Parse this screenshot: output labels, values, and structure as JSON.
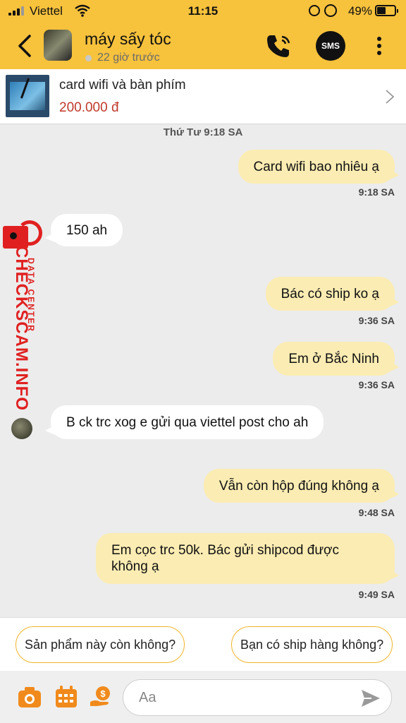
{
  "status_bar": {
    "carrier": "Viettel",
    "time": "11:15",
    "battery": "49%"
  },
  "header": {
    "title": "máy sấy tóc",
    "last_seen": "22 giờ trước",
    "sms_label": "SMS"
  },
  "product": {
    "name": "card wifi và bàn phím",
    "price": "200.000 đ"
  },
  "chat": {
    "day_label": "Thứ Tư 9:18 SA",
    "messages": [
      {
        "text": "Card wifi bao nhiêu ạ",
        "time": "9:18 SA"
      },
      {
        "text": "150 ah"
      },
      {
        "text": "Bác có ship ko ạ",
        "time": "9:36 SA"
      },
      {
        "text": "Em ở Bắc Ninh",
        "time": "9:36 SA"
      },
      {
        "text": "B ck trc xog e gửi qua viettel post cho ah"
      },
      {
        "text": "Vẫn còn hộp đúng không ạ",
        "time": "9:48 SA"
      },
      {
        "text": "Em cọc trc 50k. Bác gửi shipcod được không ạ",
        "time": "9:49 SA"
      }
    ]
  },
  "watermark": {
    "brand": "CHECKSCAM.INFO",
    "sub": "DATA CENTER"
  },
  "quick_replies": [
    "Sản phẩm này còn không?",
    "Bạn có ship hàng không?"
  ],
  "composer": {
    "placeholder": "Aa"
  },
  "colors": {
    "header_bg": "#f7c23c",
    "my_bubble": "#fbecb3",
    "price": "#c0392b",
    "accent_orange": "#f08a1c",
    "watermark": "#e02020"
  }
}
